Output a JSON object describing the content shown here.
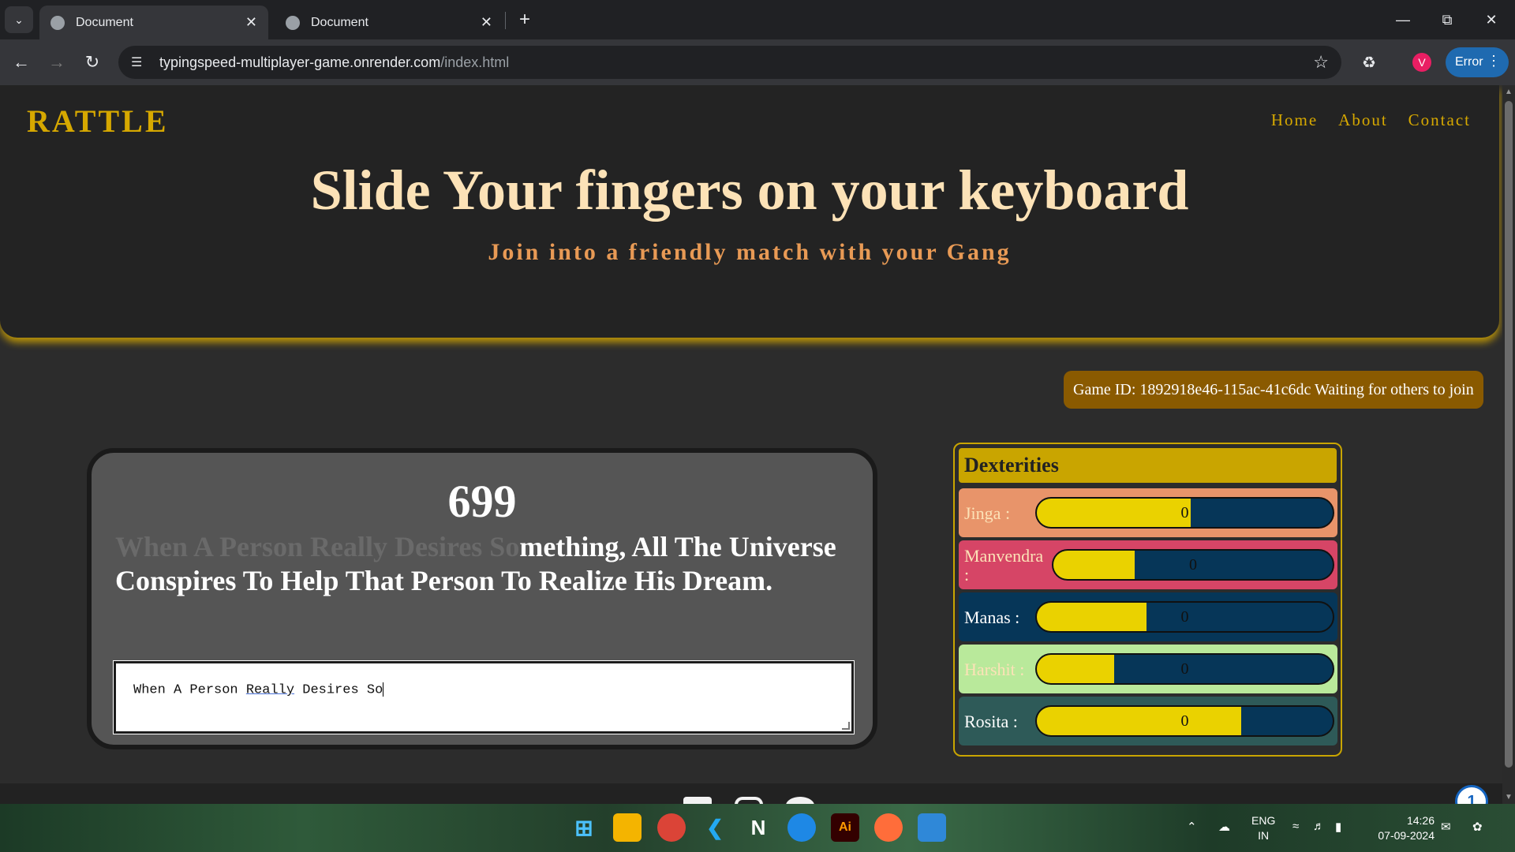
{
  "browser": {
    "tabs": [
      {
        "title": "Document",
        "active": true
      },
      {
        "title": "Document",
        "active": false
      }
    ],
    "url_host": "typingspeed-multiplayer-game.onrender.com",
    "url_path": "/index.html",
    "profile_initial": "V",
    "error_label": "Error"
  },
  "site": {
    "brand": "RATTLE",
    "nav": [
      "Home",
      "About",
      "Contact"
    ],
    "headline": "Slide Your fingers on your keyboard",
    "subline": "Join into a friendly match with your Gang",
    "game_status": "Game ID: 1892918e46-115ac-41c6dc Waiting for others to join"
  },
  "typing": {
    "counter": "699",
    "quote_done": "When A Person Really Desires So",
    "quote_remaining": "mething, All The Universe Conspires To Help That Person To Realize His Dream.",
    "input_before": "When A Person ",
    "input_marked": "Really",
    "input_after": " Desires So"
  },
  "dexterities": {
    "title": "Dexterities",
    "players": [
      {
        "name": "Jinga :",
        "score": "0",
        "progress": 0.52,
        "row_color": "#e8946a",
        "name_color": "#fce2b7"
      },
      {
        "name": "Manvendra :",
        "score": "0",
        "progress": 0.29,
        "row_color": "#d64566",
        "name_color": "#fce2b7"
      },
      {
        "name": "Manas :",
        "score": "0",
        "progress": 0.37,
        "row_color": "#063658",
        "name_color": "#ffffff"
      },
      {
        "name": "Harshit :",
        "score": "0",
        "progress": 0.26,
        "row_color": "#b9e99b",
        "name_color": "#fce2b7"
      },
      {
        "name": "Rosita :",
        "score": "0",
        "progress": 0.69,
        "row_color": "#2e5a58",
        "name_color": "#ffffff"
      }
    ]
  },
  "help_badge": "1",
  "taskbar": {
    "lang_top": "ENG",
    "lang_bottom": "IN",
    "time": "14:26",
    "date": "07-09-2024"
  }
}
